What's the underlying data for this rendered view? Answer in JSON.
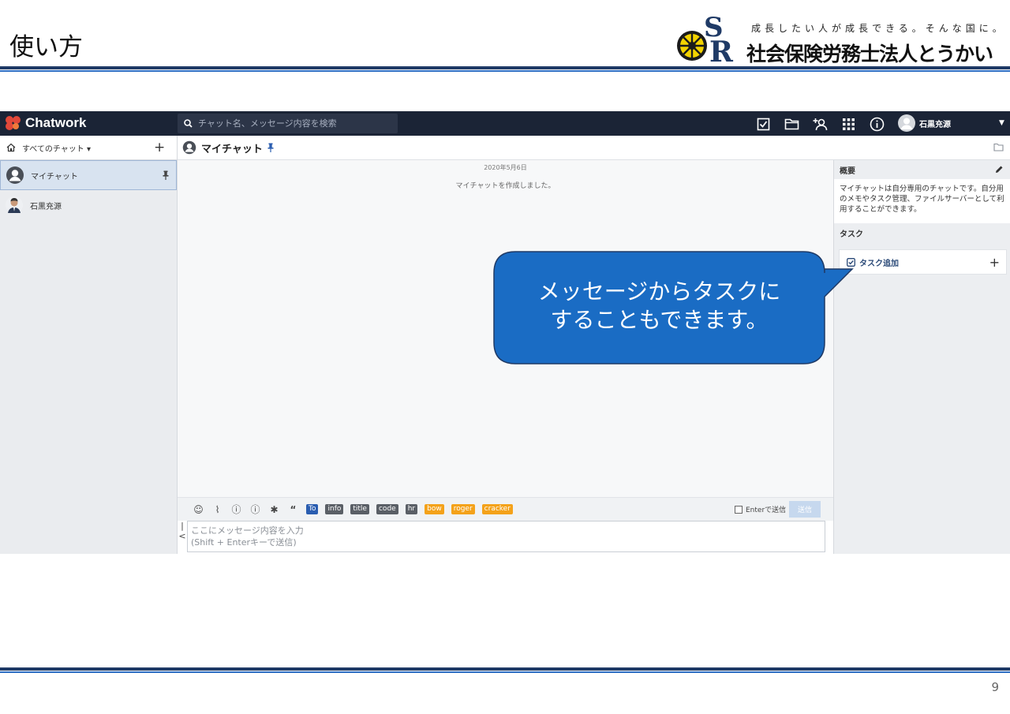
{
  "slide": {
    "title": "使い方",
    "tagline": "成長したい人が成長できる。そんな国に。",
    "company": "社会保険労務士法人とうかい",
    "page_number": "9"
  },
  "app": {
    "brand": "Chatwork",
    "search_placeholder": "チャット名、メッセージ内容を検索",
    "user_name": "石黒充源",
    "colors": {
      "topbar": "#1b2436",
      "accent_blue": "#1a6cc4",
      "tag_orange": "#f4a21a"
    }
  },
  "sidebar": {
    "filter_label": "すべてのチャット ▾",
    "rooms": [
      {
        "name": "マイチャット",
        "active": true,
        "pinned": true
      },
      {
        "name": "石黒充源",
        "active": false,
        "pinned": false
      }
    ]
  },
  "chat": {
    "title": "マイチャット",
    "date": "2020年5月6日",
    "system_message": "マイチャットを作成しました。"
  },
  "right_panel": {
    "overview_title": "概要",
    "overview_text": "マイチャットは自分専用のチャットです。自分用のメモやタスク管理、ファイルサーバーとして利用することができます。",
    "task_title": "タスク",
    "task_add_label": "タスク追加"
  },
  "composer": {
    "tags": [
      "To",
      "info",
      "title",
      "code",
      "hr",
      "bow",
      "roger",
      "cracker"
    ],
    "enter_option": "Enterで送信",
    "send_label": "送信",
    "placeholder": "ここにメッセージ内容を入力\n(Shift + Enterキーで送信)"
  },
  "callout": {
    "line1": "メッセージからタスクに",
    "line2": "することもできます。"
  }
}
